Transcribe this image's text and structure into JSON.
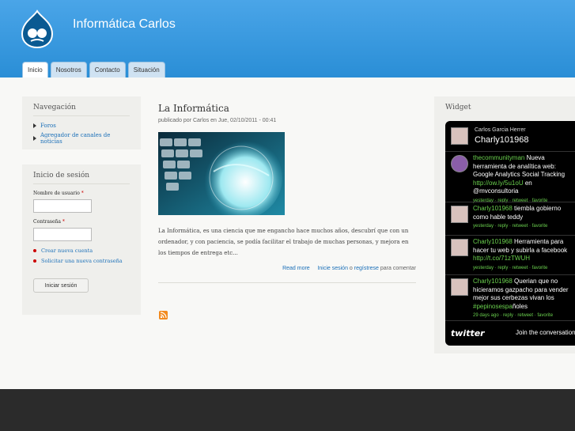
{
  "site": {
    "name": "Informática Carlos"
  },
  "tabs": [
    {
      "label": "Inicio",
      "active": true
    },
    {
      "label": "Nosotros"
    },
    {
      "label": "Contacto"
    },
    {
      "label": "Situación"
    }
  ],
  "navigation": {
    "title": "Navegación",
    "items": [
      {
        "label": "Foros"
      },
      {
        "label": "Agregador de canales de noticias"
      }
    ]
  },
  "login": {
    "title": "Inicio de sesión",
    "username_label": "Nombre de usuario",
    "password_label": "Contraseña",
    "required_mark": "*",
    "links": [
      {
        "label": "Crear nueva cuenta"
      },
      {
        "label": "Solicitar una nueva contraseña"
      }
    ],
    "submit_label": "Iniciar sesión"
  },
  "article": {
    "title": "La Informática",
    "submitted": "publicado por Carlos en Jue, 02/10/2011 - 00:41",
    "body": "La Informática, es una ciencia que me engancho hace muchos años, descubrí que con un ordenador, y con paciencia, se podía facilitar el trabajo de muchas personas, y mejora en los tiempos de entrega etc...",
    "read_more": "Read more",
    "login_link": "Inicie sesión",
    "or_text": "o",
    "register_link": "regístrese",
    "comment_text": "para comentar"
  },
  "widget": {
    "title": "Widget",
    "profile_name": "Carlos Garcia Herrer",
    "profile_handle": "Charly101968",
    "tweets": [
      {
        "user": "thecommunityman",
        "text": "Nueva herramienta de analítica web: Google Analytics Social Tracking",
        "link": "http://ow.ly/5u1oU",
        "after": "en @mvconsultoria",
        "meta": "yesterday · reply · retweet · favorite"
      },
      {
        "user": "Charly101968",
        "text": "tiembla gobierno como hable teddy",
        "meta": "yesterday · reply · retweet · favorite"
      },
      {
        "user": "Charly101968",
        "text": "Herramienta para hacer tu web y subirla a facebook",
        "link": "http://t.co/71zTWUH",
        "meta": "yesterday · reply · retweet · favorite"
      },
      {
        "user": "Charly101968",
        "text": "Querian que no hicieramos gazpacho para vender mejor sus cerbezas vivan los",
        "hashtag": "#pepinosespa",
        "after": "ñoles",
        "meta": "29 days ago · reply · retweet · favorite"
      }
    ],
    "twitter_logo": "twitter",
    "join_text": "Join the conversation"
  }
}
